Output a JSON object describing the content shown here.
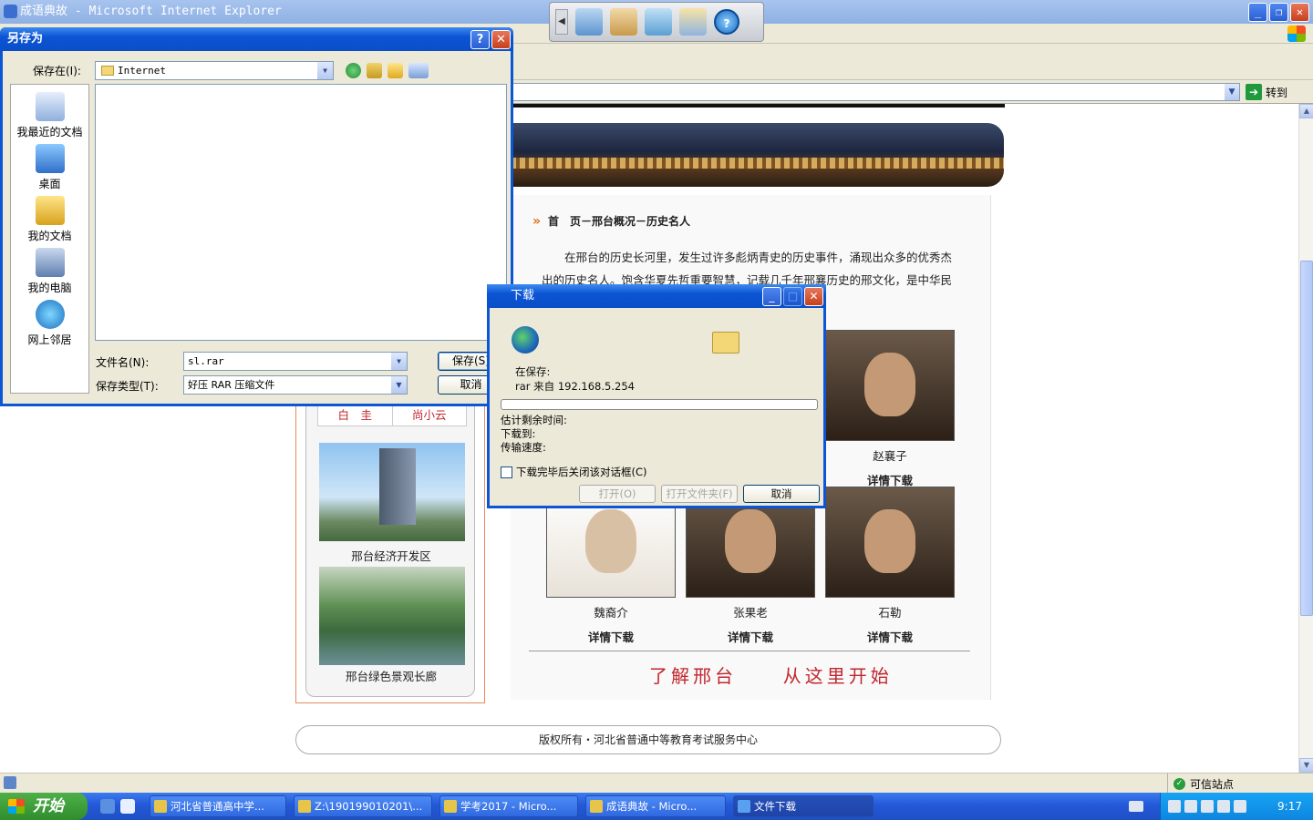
{
  "ie": {
    "title": "成语典故 - Microsoft Internet Explorer",
    "go_label": "转到"
  },
  "page": {
    "breadcrumb": "首　页－邢台概况－历史名人",
    "intro": "在邢台的历史长河里，发生过许多彪炳青史的历史事件，涌现出众多的优秀杰出的历史名人。饱含华夏先哲重要智慧，记载几千年邢襄历史的邢文化，是中华民族宝贵财富。",
    "people": [
      {
        "name": "赵襄子",
        "download": "详情下载"
      },
      {
        "name": "魏裔介",
        "download": "详情下载"
      },
      {
        "name": "张果老",
        "download": "详情下载"
      },
      {
        "name": "石勒",
        "download": "详情下载"
      }
    ],
    "slogan_left": "了解邢台",
    "slogan_right": "从这里开始",
    "side_tabs": [
      "白　圭",
      "尚小云"
    ],
    "side_captions": [
      "邢台经济开发区",
      "邢台绿色景观长廊"
    ],
    "footer": "版权所有・河北省普通中等教育考试服务中心"
  },
  "save_dialog": {
    "title": "另存为",
    "save_in_label": "保存在(I):",
    "save_in_value": "Internet",
    "places": [
      "我最近的文档",
      "桌面",
      "我的文档",
      "我的电脑",
      "网上邻居"
    ],
    "filename_label": "文件名(N):",
    "filename_value": "sl.rar",
    "filetype_label": "保存类型(T):",
    "filetype_value": "好压 RAR 压缩文件",
    "save_button": "保存(S)",
    "cancel_button": "取消"
  },
  "download_dialog": {
    "title": "下载",
    "saving": "在保存:",
    "source": "rar 来自 192.168.5.254",
    "est_time": "估计剩余时间:",
    "download_to": "下载到:",
    "transfer_rate": "传输速度:",
    "close_when_done": "下载完毕后关闭该对话框(C)",
    "open_button": "打开(O)",
    "open_folder_button": "打开文件夹(F)",
    "cancel_button": "取消"
  },
  "status": {
    "zone": "可信站点"
  },
  "taskbar": {
    "start": "开始",
    "tasks": [
      "河北省普通高中学...",
      "Z:\\190199010201\\...",
      "学考2017 - Micro...",
      "成语典故 - Micro...",
      "文件下载"
    ],
    "clock": "9:17"
  },
  "colors": {
    "accent_red": "#c1272d",
    "xp_blue": "#0b56d6"
  }
}
